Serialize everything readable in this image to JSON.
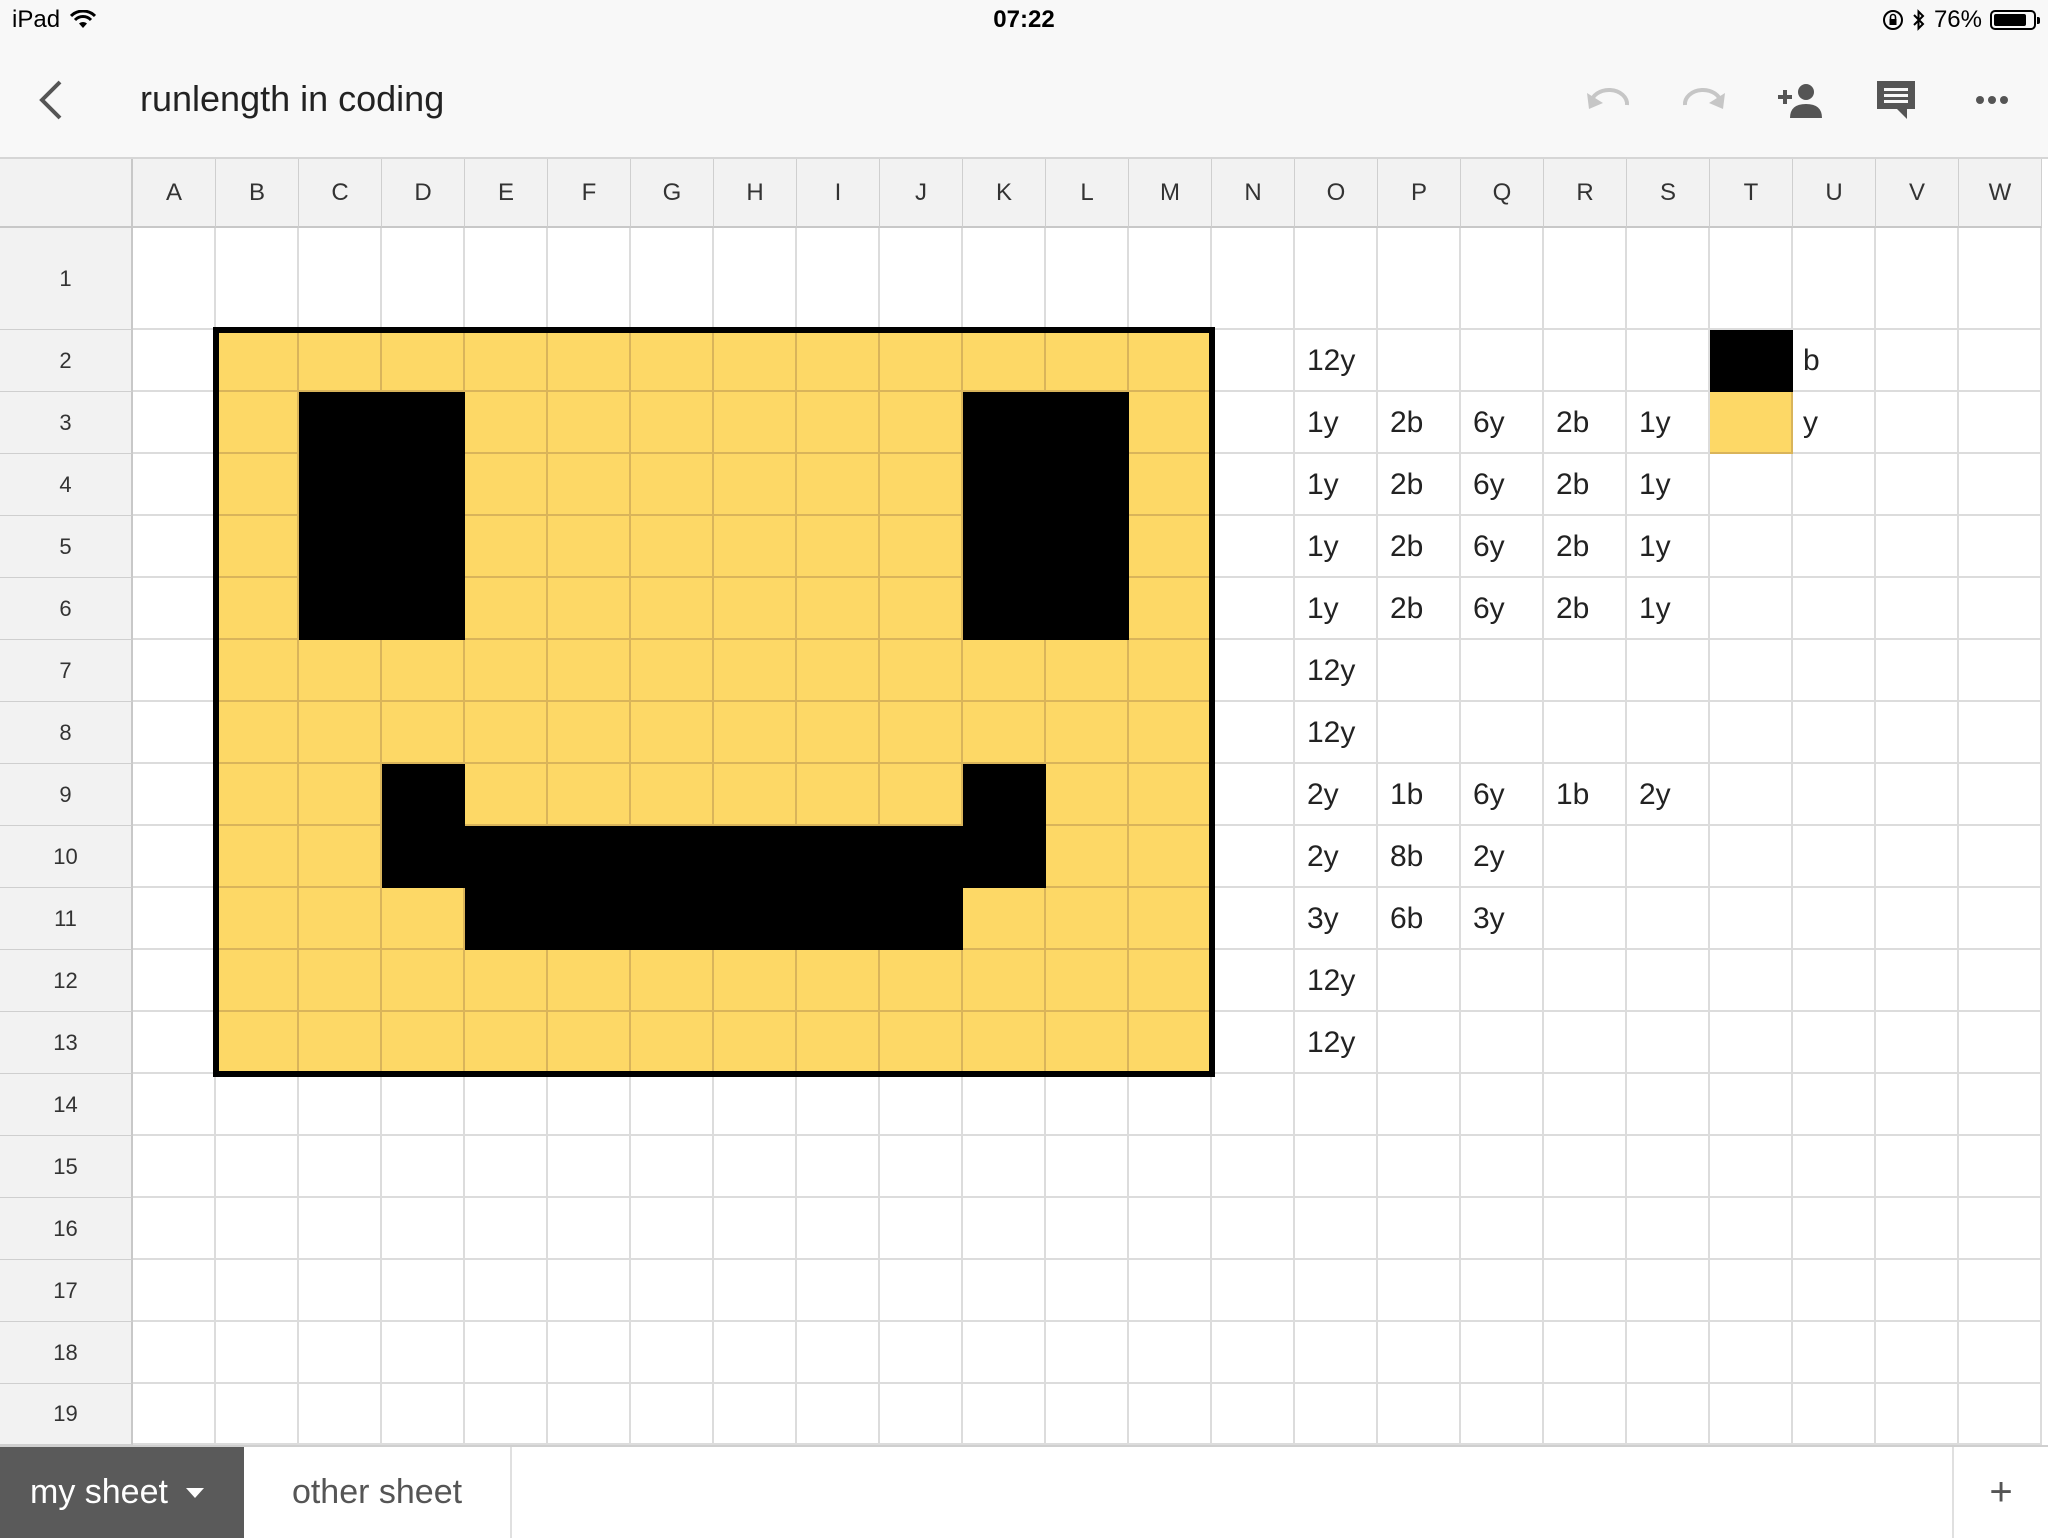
{
  "status_bar": {
    "device": "iPad",
    "time": "07:22",
    "battery": "76%",
    "battery_level": 0.76,
    "icons": [
      "wifi-icon",
      "orientation-lock-icon",
      "bluetooth-icon",
      "battery-icon"
    ]
  },
  "app_bar": {
    "title": "runlength in coding",
    "buttons": [
      "back-icon",
      "undo-icon",
      "redo-icon",
      "add-person-icon",
      "comment-icon",
      "more-icon"
    ]
  },
  "columns": [
    "A",
    "B",
    "C",
    "D",
    "E",
    "F",
    "G",
    "H",
    "I",
    "J",
    "K",
    "L",
    "M",
    "N",
    "O",
    "P",
    "Q",
    "R",
    "S",
    "T",
    "U",
    "V",
    "W"
  ],
  "rows": [
    "1",
    "2",
    "3",
    "4",
    "5",
    "6",
    "7",
    "8",
    "9",
    "10",
    "11",
    "12",
    "13",
    "14",
    "15",
    "16",
    "17",
    "18",
    "19"
  ],
  "colors": {
    "yellow": "#fdd866",
    "black": "#000000",
    "header": "#f2f2f2",
    "active_tab": "#5a5a5a"
  },
  "pixel_art": [
    "yyyyyyyyyyyy",
    "ybbyyyyyybby",
    "ybbyyyyyybby",
    "ybbyyyyyybby",
    "ybbyyyyyybby",
    "yyyyyyyyyyyy",
    "yyyyyyyyyyyy",
    "yybyyyyyybyy",
    "yybbbbbbbbyy",
    "yyybbbbbbyyy",
    "yyyyyyyyyyyy",
    "yyyyyyyyyyyy"
  ],
  "encoding": [
    [
      "12y"
    ],
    [
      "1y",
      "2b",
      "6y",
      "2b",
      "1y"
    ],
    [
      "1y",
      "2b",
      "6y",
      "2b",
      "1y"
    ],
    [
      "1y",
      "2b",
      "6y",
      "2b",
      "1y"
    ],
    [
      "1y",
      "2b",
      "6y",
      "2b",
      "1y"
    ],
    [
      "12y"
    ],
    [
      "12y"
    ],
    [
      "2y",
      "1b",
      "6y",
      "1b",
      "2y"
    ],
    [
      "2y",
      "8b",
      "2y"
    ],
    [
      "3y",
      "6b",
      "3y"
    ],
    [
      "12y"
    ],
    [
      "12y"
    ]
  ],
  "legend": [
    {
      "color": "#000000",
      "label": "b"
    },
    {
      "color": "#fdd866",
      "label": "y"
    }
  ],
  "tabs": {
    "active": "my sheet",
    "other": "other sheet",
    "add": "+"
  }
}
